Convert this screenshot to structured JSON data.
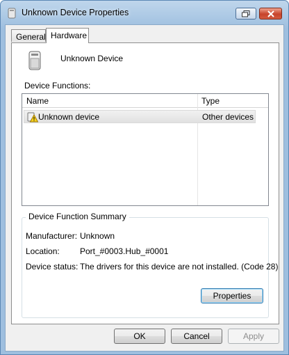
{
  "window": {
    "title": "Unknown Device Properties"
  },
  "tabs": [
    {
      "label": "General",
      "selected": false
    },
    {
      "label": "Hardware",
      "selected": true
    }
  ],
  "device": {
    "name": "Unknown Device"
  },
  "functions": {
    "label": "Device Functions:",
    "columns": [
      "Name",
      "Type"
    ],
    "rows": [
      {
        "name": "Unknown device",
        "type": "Other devices",
        "icon": "warning-icon"
      }
    ]
  },
  "summary": {
    "legend": "Device Function Summary",
    "manufacturer_label": "Manufacturer:",
    "manufacturer_value": "Unknown",
    "location_label": "Location:",
    "location_value": "Port_#0003.Hub_#0001",
    "status_label": "Device status:",
    "status_value": "The drivers for this device are not installed. (Code 28)",
    "properties_button": "Properties"
  },
  "buttons": {
    "ok": "OK",
    "cancel": "Cancel",
    "apply": "Apply"
  }
}
